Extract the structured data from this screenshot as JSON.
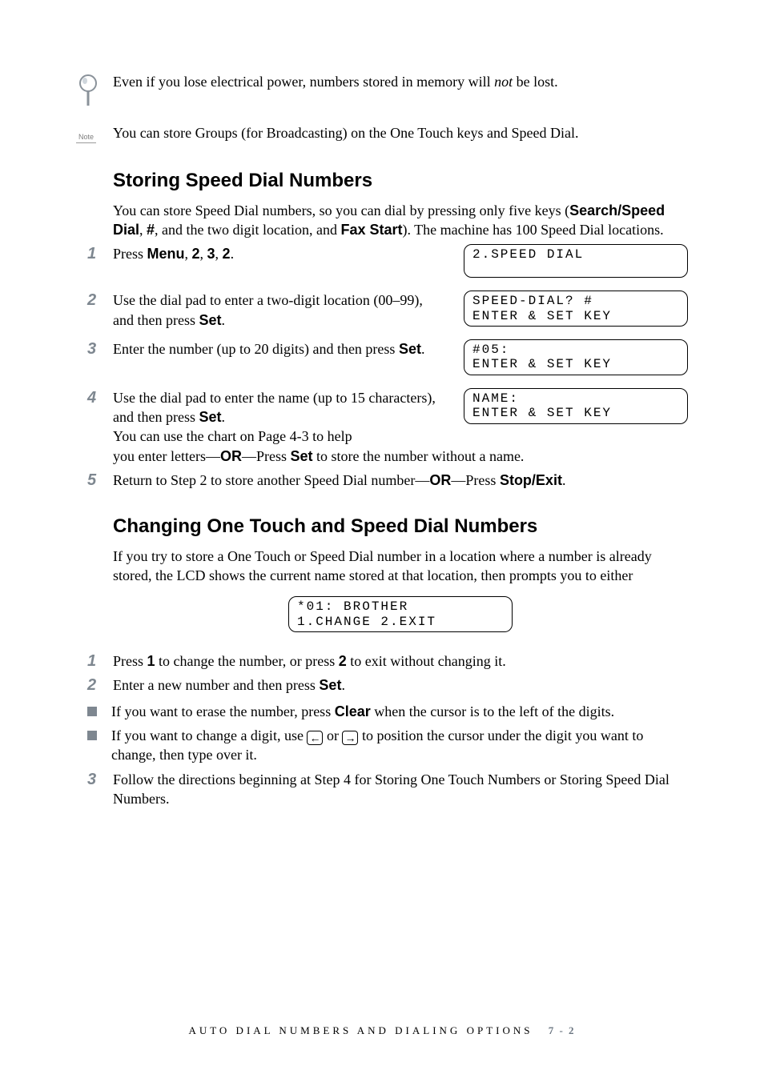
{
  "tip": {
    "text_before": "Even if you lose electrical power, numbers stored in memory will ",
    "emph": "not",
    "text_after": " be lost."
  },
  "note": {
    "label": "Note",
    "text": "You can store Groups (for Broadcasting) on the One Touch keys and Speed Dial."
  },
  "sec1": {
    "title": "Storing Speed Dial Numbers",
    "intro_1": "You can store Speed Dial numbers, so you can dial by pressing only five keys (",
    "intro_b1": "Search/Speed Dial",
    "intro_2": ", ",
    "intro_b2": "#",
    "intro_3": ", and the two digit location, and ",
    "intro_b3": "Fax Start",
    "intro_4": "). The machine has 100 Speed Dial locations.",
    "steps": {
      "s1": {
        "n": "1",
        "a": "Press ",
        "b1": "Menu",
        "mid1": ", ",
        "b2": "2",
        "mid2": ", ",
        "b3": "3",
        "mid3": ", ",
        "b4": "2",
        "end": "."
      },
      "s2": {
        "n": "2",
        "a": "Use the dial pad to enter a two-digit location (00–99), and then press ",
        "b": "Set",
        "end": "."
      },
      "s3": {
        "n": "3",
        "a": "Enter the number (up to 20 digits) and then press ",
        "b": "Set",
        "end": "."
      },
      "s4": {
        "n": "4",
        "a": "Use the dial pad to enter the name (up to 15 characters), and then press ",
        "b1": "Set",
        "mid1": ".\nYou can use the chart on Page 4-3 to help you enter letters—",
        "b2": "OR",
        "mid2": "—Press ",
        "b3": "Set",
        "end": " to store the number without a name."
      },
      "s5": {
        "n": "5",
        "a": "Return to Step 2 to store another Speed Dial number—",
        "b1": "OR",
        "mid1": "—Press ",
        "b2": "Stop/Exit",
        "end": "."
      }
    },
    "lcd": {
      "d1": "2.SPEED DIAL",
      "d2": "SPEED-DIAL? #\nENTER & SET KEY",
      "d3": "#05:\nENTER & SET KEY",
      "d4": "NAME:\nENTER & SET KEY"
    }
  },
  "sec2": {
    "title": "Changing One Touch and Speed Dial Numbers",
    "intro": "If you try to store a One Touch or Speed Dial number in a location where a number is already stored, the LCD shows the current name stored at that location, then prompts you to either",
    "lcd": "*01: BROTHER\n1.CHANGE 2.EXIT",
    "steps": {
      "s1": {
        "n": "1",
        "a": "Press ",
        "b1": "1",
        "mid": " to change the number, or press ",
        "b2": "2",
        "end": " to exit without changing it."
      },
      "s2": {
        "n": "2",
        "a": "Enter a new number and then press ",
        "b": "Set",
        "end": "."
      },
      "s3": {
        "n": "3",
        "text": "Follow the directions beginning at Step 4 for Storing One Touch Numbers or Storing Speed Dial Numbers."
      }
    },
    "bullets": {
      "b1": {
        "a": "If you want to erase the number, press ",
        "b": "Clear",
        "end": " when the cursor is to the left of the digits."
      },
      "b2": {
        "a": "If you want to change a digit, use ",
        "left": "←",
        "mid": " or ",
        "right": "→",
        "end": " to position the cursor under the digit you want to change, then type over it."
      }
    }
  },
  "footer": {
    "title": "AUTO DIAL NUMBERS AND DIALING OPTIONS",
    "page": "7 - 2"
  }
}
